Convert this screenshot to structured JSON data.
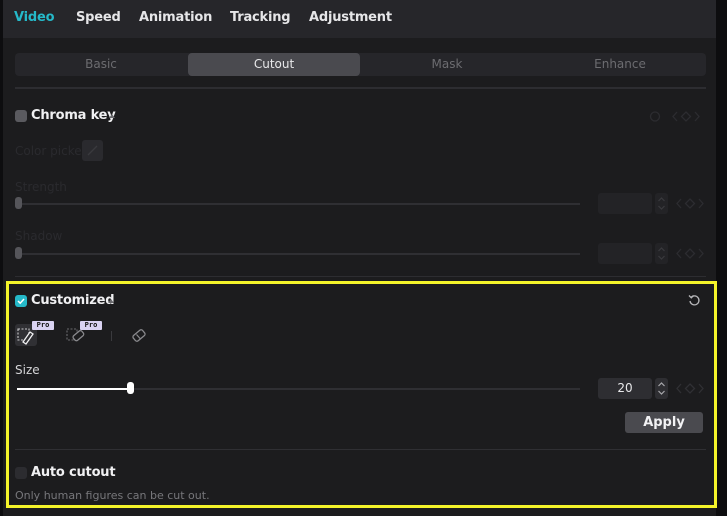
{
  "top_tabs": [
    {
      "label": "Video",
      "active": true
    },
    {
      "label": "Speed",
      "active": false
    },
    {
      "label": "Animation",
      "active": false
    },
    {
      "label": "Tracking",
      "active": false
    },
    {
      "label": "Adjustment",
      "active": false
    }
  ],
  "sub_tabs": [
    {
      "label": "Basic",
      "active": false
    },
    {
      "label": "Cutout",
      "active": true
    },
    {
      "label": "Mask",
      "active": false
    },
    {
      "label": "Enhance",
      "active": false
    }
  ],
  "chroma_key": {
    "title": "Chroma key",
    "checked": false,
    "disabled": true,
    "color_picker_label": "Color picker",
    "strength_label": "Strength",
    "strength_value": "",
    "shadow_label": "Shadow",
    "shadow_value": ""
  },
  "customized": {
    "title": "Customized",
    "checked": true,
    "tools": [
      {
        "name": "smart-brush",
        "badge": "Pro",
        "active": true
      },
      {
        "name": "smart-eraser",
        "badge": "Pro",
        "active": false
      },
      {
        "name": "eraser",
        "badge": "",
        "active": false
      }
    ],
    "size_label": "Size",
    "size_value": "20",
    "size_fraction": 0.2,
    "apply_label": "Apply"
  },
  "auto_cutout": {
    "title": "Auto cutout",
    "checked": false,
    "hint": "Only human figures can be cut out."
  },
  "colors": {
    "accent": "#25b9c9",
    "highlight_border": "#f4f32a",
    "pro_badge": "#d9d2f2"
  }
}
